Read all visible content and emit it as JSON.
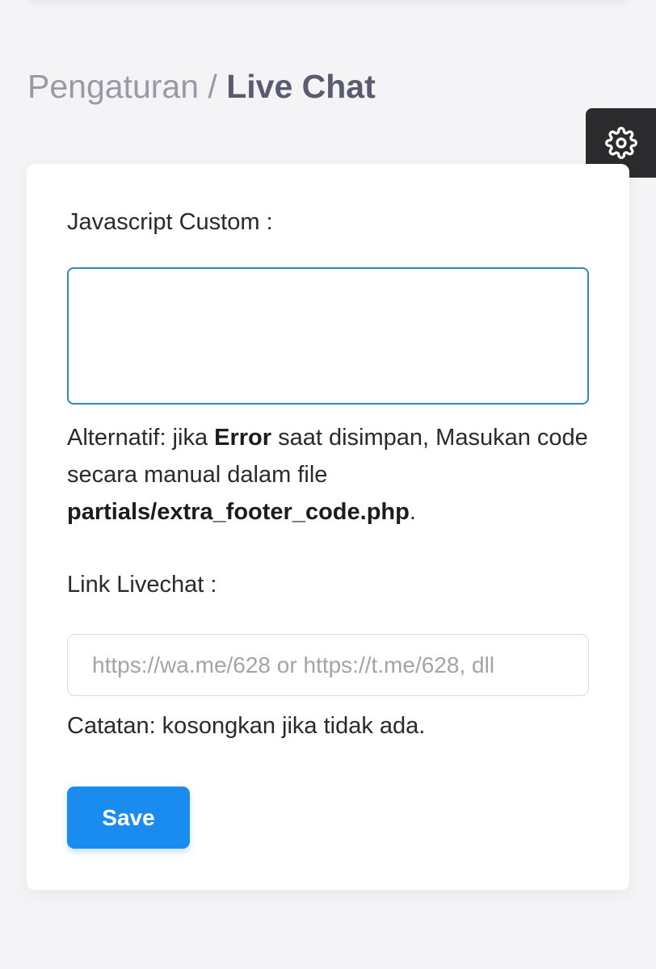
{
  "breadcrumb": {
    "parent": "Pengaturan",
    "separator": " / ",
    "current": "Live Chat"
  },
  "settings_button": {
    "icon": "gear-icon"
  },
  "form": {
    "js_label": "Javascript Custom :",
    "js_value": "",
    "help": {
      "part1": "Alternatif: jika ",
      "bold1": "Error",
      "part2": " saat disimpan, Masukan code secara manual dalam file ",
      "bold2": "partials/extra_footer_code.php",
      "part3": "."
    },
    "link_label": "Link Livechat :",
    "link_value": "",
    "link_placeholder": "https://wa.me/628 or https://t.me/628, dll",
    "note": "Catatan: kosongkan jika tidak ada.",
    "save_label": "Save"
  },
  "colors": {
    "accent": "#1a8cf0",
    "textarea_focus_border": "#2d88c9",
    "fab_background": "#2b2b2e",
    "page_background": "#f4f4f7"
  }
}
